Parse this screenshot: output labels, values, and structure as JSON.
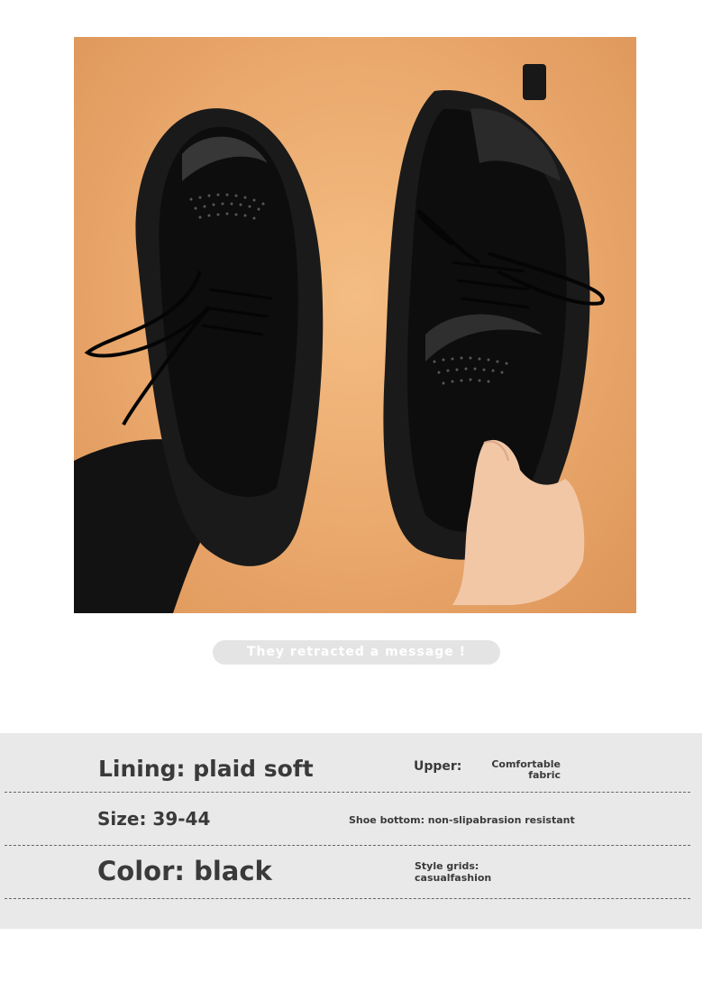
{
  "image": {
    "subject": "black-shoes-icon"
  },
  "notice": {
    "text": "They retracted a message !"
  },
  "specs": {
    "lining": "Lining: plaid soft",
    "upper_label": "Upper:",
    "upper_value_line1": "Comfortable",
    "upper_value_line2": "fabric",
    "size": "Size: 39-44",
    "shoe_bottom": "Shoe bottom: non-slipabrasion resistant",
    "color": "Color: black",
    "style_label": "Style grids:",
    "style_value": "casualfashion"
  },
  "colors": {
    "background_orange": "#eaa86c",
    "panel_gray": "#e9e9e9",
    "text_dark": "#3a3a3a"
  }
}
